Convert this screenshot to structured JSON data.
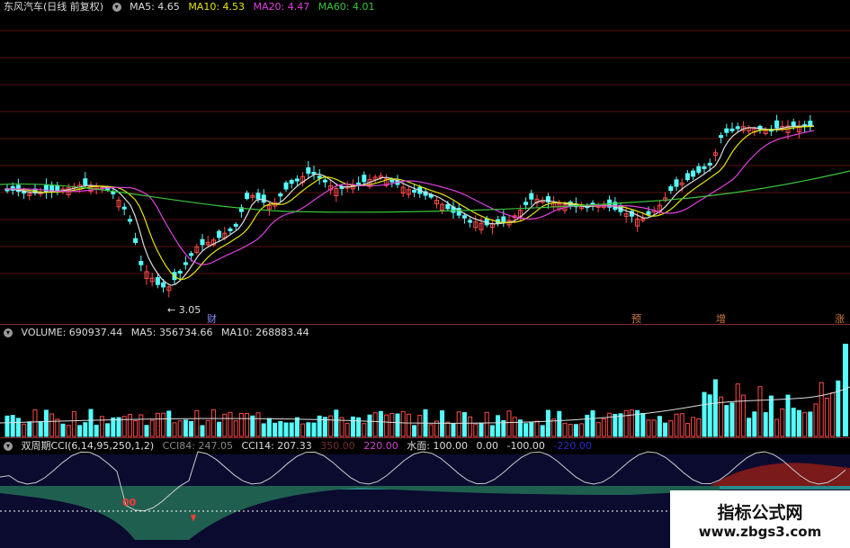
{
  "colors": {
    "up": "#ff4a4a",
    "down": "#54ffff",
    "ma5": "#dddddd",
    "ma10": "#e6e600",
    "ma20": "#e040e0",
    "ma60": "#3cc43c",
    "volume_label": "#dddddd",
    "grid": "#5a0f0f"
  },
  "price_panel": {
    "title": "东风汽车(日线 前复权)",
    "indicators": [
      {
        "label": "MA5: 4.65",
        "color": "#dddddd"
      },
      {
        "label": "MA10: 4.53",
        "color": "#e6e600"
      },
      {
        "label": "MA20: 4.47",
        "color": "#e040e0"
      },
      {
        "label": "MA60: 4.01",
        "color": "#3cc43c"
      }
    ],
    "low_marker": "3.05",
    "event_markers": [
      "财",
      "预",
      "增",
      "涨"
    ]
  },
  "volume_panel": {
    "indicators": [
      {
        "label": "VOLUME: 690937.44",
        "color": "#dddddd"
      },
      {
        "label": "MA5: 356734.66",
        "color": "#e6e600"
      },
      {
        "label": "MA10: 268883.44",
        "color": "#e040e0"
      }
    ]
  },
  "cci_panel": {
    "title": "双周期CCI(6,14,95,250,1,2)",
    "indicators": [
      {
        "label": "CCI84: 247.05",
        "color": "#888888"
      },
      {
        "label": "CCI14: 207.33",
        "color": "#dddddd"
      },
      {
        "label": "350.00",
        "color": "#7a2a2a"
      },
      {
        "label": "220.00",
        "color": "#d040d0"
      },
      {
        "label": "水面: 100.00",
        "color": "#dddddd"
      },
      {
        "label": "0.00",
        "color": "#dddddd"
      },
      {
        "label": "-100.00",
        "color": "#dddddd"
      },
      {
        "label": "-220.00",
        "color": "#2a2ad0"
      }
    ],
    "signal_label": "00"
  },
  "watermark": {
    "line1": "指标公式网",
    "line2": "www.zbgs3.com"
  }
}
